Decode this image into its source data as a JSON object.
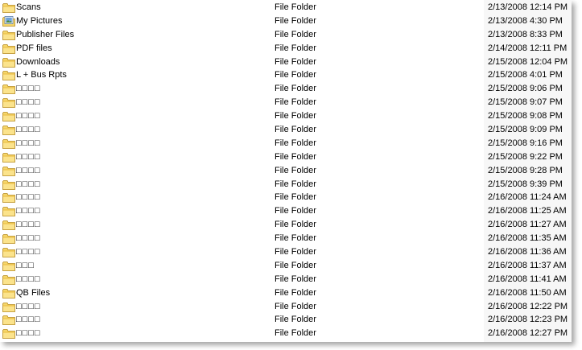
{
  "rows": [
    {
      "name": "Scans",
      "type": "File Folder",
      "date": "2/13/2008 12:14 PM",
      "icon": "folder-icon"
    },
    {
      "name": "My Pictures",
      "type": "File Folder",
      "date": "2/13/2008 4:30 PM",
      "icon": "pictures-folder-icon"
    },
    {
      "name": "Publisher Files",
      "type": "File Folder",
      "date": "2/13/2008 8:33 PM",
      "icon": "folder-icon"
    },
    {
      "name": "PDF files",
      "type": "File Folder",
      "date": "2/14/2008 12:11 PM",
      "icon": "folder-icon"
    },
    {
      "name": "Downloads",
      "type": "File Folder",
      "date": "2/15/2008 12:04 PM",
      "icon": "folder-icon"
    },
    {
      "name": "L + Bus Rpts",
      "type": "File Folder",
      "date": "2/15/2008 4:01 PM",
      "icon": "folder-icon"
    },
    {
      "name": "□□□□",
      "type": "File Folder",
      "date": "2/15/2008 9:06 PM",
      "icon": "folder-icon"
    },
    {
      "name": "□□□□",
      "type": "File Folder",
      "date": "2/15/2008 9:07 PM",
      "icon": "folder-icon"
    },
    {
      "name": "□□□□",
      "type": "File Folder",
      "date": "2/15/2008 9:08 PM",
      "icon": "folder-icon"
    },
    {
      "name": "□□□□",
      "type": "File Folder",
      "date": "2/15/2008 9:09 PM",
      "icon": "folder-icon"
    },
    {
      "name": "□□□□",
      "type": "File Folder",
      "date": "2/15/2008 9:16 PM",
      "icon": "folder-icon"
    },
    {
      "name": "□□□□",
      "type": "File Folder",
      "date": "2/15/2008 9:22 PM",
      "icon": "folder-icon"
    },
    {
      "name": "□□□□",
      "type": "File Folder",
      "date": "2/15/2008 9:28 PM",
      "icon": "folder-icon"
    },
    {
      "name": "□□□□",
      "type": "File Folder",
      "date": "2/15/2008 9:39 PM",
      "icon": "folder-icon"
    },
    {
      "name": "□□□□",
      "type": "File Folder",
      "date": "2/16/2008 11:24 AM",
      "icon": "folder-icon"
    },
    {
      "name": "□□□□",
      "type": "File Folder",
      "date": "2/16/2008 11:25 AM",
      "icon": "folder-icon"
    },
    {
      "name": "□□□□",
      "type": "File Folder",
      "date": "2/16/2008 11:27 AM",
      "icon": "folder-icon"
    },
    {
      "name": "□□□□",
      "type": "File Folder",
      "date": "2/16/2008 11:35 AM",
      "icon": "folder-icon"
    },
    {
      "name": "□□□□",
      "type": "File Folder",
      "date": "2/16/2008 11:36 AM",
      "icon": "folder-icon"
    },
    {
      "name": "□□□",
      "type": "File Folder",
      "date": "2/16/2008 11:37 AM",
      "icon": "folder-icon"
    },
    {
      "name": "□□□□",
      "type": "File Folder",
      "date": "2/16/2008 11:41 AM",
      "icon": "folder-icon"
    },
    {
      "name": "QB Files",
      "type": "File Folder",
      "date": "2/16/2008 11:50 AM",
      "icon": "folder-icon"
    },
    {
      "name": "□□□□",
      "type": "File Folder",
      "date": "2/16/2008 12:22 PM",
      "icon": "folder-icon"
    },
    {
      "name": "□□□□",
      "type": "File Folder",
      "date": "2/16/2008 12:23 PM",
      "icon": "folder-icon"
    },
    {
      "name": "□□□□",
      "type": "File Folder",
      "date": "2/16/2008 12:27 PM",
      "icon": "folder-icon"
    }
  ],
  "colors": {
    "folder_body": "#f5d66b",
    "folder_tab": "#e9b93d",
    "folder_outline": "#b68a1f",
    "date_column_bg": "#f7f7f7"
  }
}
